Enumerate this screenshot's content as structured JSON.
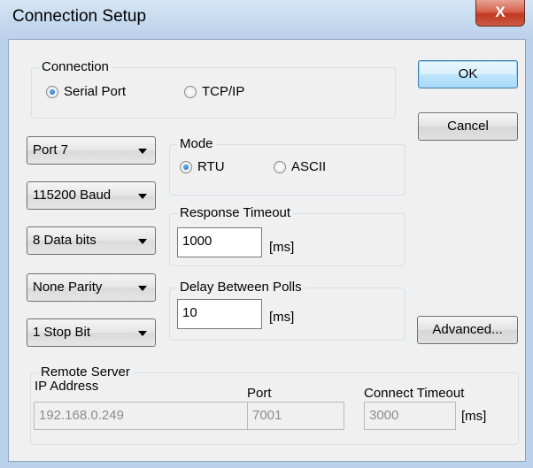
{
  "window": {
    "title": "Connection Setup",
    "close_glyph": "X"
  },
  "connection": {
    "label": "Connection",
    "options": [
      {
        "label": "Serial Port",
        "selected": true
      },
      {
        "label": "TCP/IP",
        "selected": false
      }
    ]
  },
  "buttons": {
    "ok": "OK",
    "cancel": "Cancel",
    "advanced": "Advanced..."
  },
  "serial": {
    "port": "Port 7",
    "baud": "115200 Baud",
    "data_bits": "8 Data bits",
    "parity": "None Parity",
    "stop_bits": "1 Stop Bit"
  },
  "mode": {
    "label": "Mode",
    "options": [
      {
        "label": "RTU",
        "selected": true
      },
      {
        "label": "ASCII",
        "selected": false
      }
    ]
  },
  "response_timeout": {
    "label": "Response Timeout",
    "value": "1000",
    "unit": "[ms]"
  },
  "delay_between_polls": {
    "label": "Delay Between Polls",
    "value": "10",
    "unit": "[ms]"
  },
  "remote_server": {
    "label": "Remote Server",
    "ip_label": "IP Address",
    "ip_value": "192.168.0.249",
    "port_label": "Port",
    "port_value": "7001",
    "timeout_label": "Connect Timeout",
    "timeout_value": "3000",
    "timeout_unit": "[ms]"
  },
  "colors": {
    "accent": "#1d5fb8",
    "close": "#c0391f"
  }
}
